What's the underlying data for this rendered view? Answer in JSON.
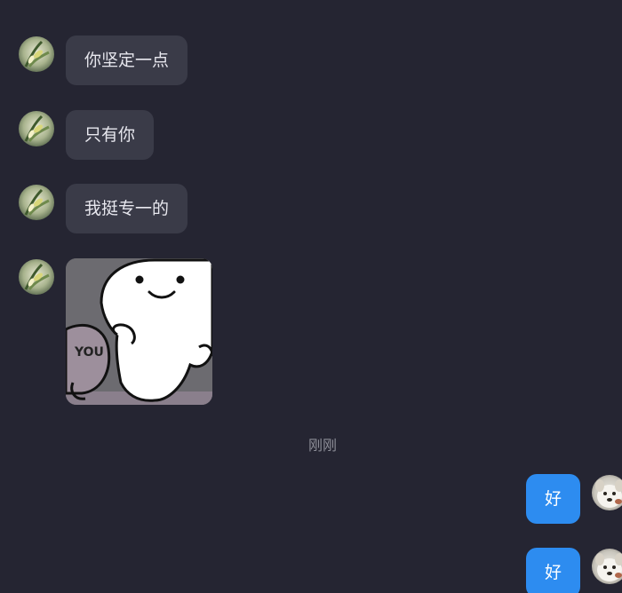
{
  "messages": [
    {
      "direction": "incoming",
      "type": "text",
      "text": "你坚定一点"
    },
    {
      "direction": "incoming",
      "type": "text",
      "text": "只有你"
    },
    {
      "direction": "incoming",
      "type": "text",
      "text": "我挺专一的"
    },
    {
      "direction": "incoming",
      "type": "sticker",
      "sticker_text": "YOU"
    },
    {
      "direction": "outgoing",
      "type": "text",
      "text": "好"
    },
    {
      "direction": "outgoing",
      "type": "text",
      "text": "好"
    }
  ],
  "timestamp": "刚刚",
  "colors": {
    "background": "#252532",
    "incoming_bubble": "#3a3b48",
    "outgoing_bubble": "#2d8cf0"
  },
  "icons": {
    "contact_avatar": "plant-photo-avatar",
    "self_avatar": "dog-photo-avatar"
  }
}
